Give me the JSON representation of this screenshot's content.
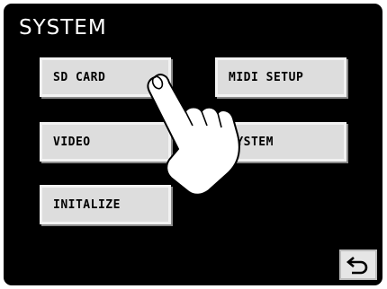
{
  "screen": {
    "title": "SYSTEM"
  },
  "menu": {
    "sd_card": "SD CARD",
    "midi_setup": "MIDI SETUP",
    "video": "VIDEO",
    "system": "SYSTEM",
    "initalize": "INITALIZE"
  },
  "footer": {
    "back_icon": "return-arrow-icon"
  },
  "overlay": {
    "pointer_icon": "pointing-hand-icon"
  },
  "colors": {
    "background": "#000000",
    "button_face": "#dddddd",
    "text": "#ffffff"
  }
}
